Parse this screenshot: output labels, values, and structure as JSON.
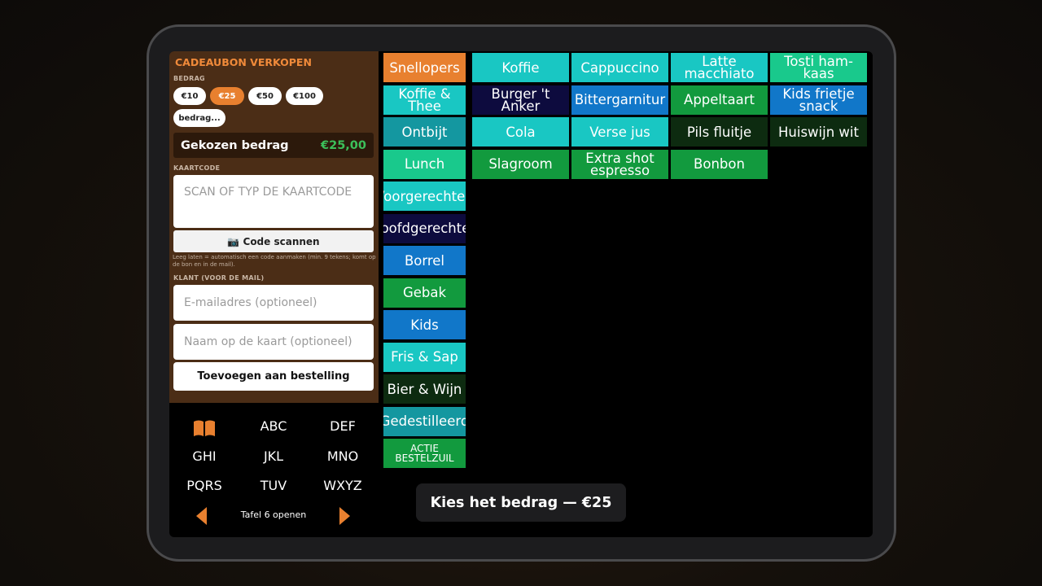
{
  "giftcard": {
    "title": "CADEAUBON VERKOPEN",
    "amount_label": "BEDRAG",
    "amounts": [
      "€10",
      "€25",
      "€50",
      "€100",
      "bedrag..."
    ],
    "selected_amount": "€25",
    "chosen_label": "Gekozen bedrag",
    "chosen_value": "€25,00",
    "code_label": "KAARTCODE",
    "code_placeholder": "SCAN OF TYP DE KAARTCODE",
    "scan_button": "📷 Code scannen",
    "hint": "Leeg laten = automatisch een code aanmaken (min. 9 tekens; komt op de bon en in de mail).",
    "customer_label": "KLANT (VOOR DE MAIL)",
    "email_placeholder": "E-mailadres (optioneel)",
    "name_placeholder": "Naam op de kaart (optioneel)",
    "add_button": "Toevoegen aan bestelling"
  },
  "keypad": {
    "keys": [
      "ABC",
      "DEF",
      "GHI",
      "JKL",
      "MNO",
      "PQRS",
      "TUV",
      "WXYZ"
    ],
    "book_icon": "book-icon",
    "table_text": "Tafel 6 openen"
  },
  "categories": [
    {
      "label": "Snellopers",
      "color": "#e8802f"
    },
    {
      "label": "Koffie & Thee",
      "color": "#19c7c3"
    },
    {
      "label": "Ontbijt",
      "color": "#1497a0"
    },
    {
      "label": "Lunch",
      "color": "#19c98c"
    },
    {
      "label": "Voorgerechten",
      "color": "#19c7c3"
    },
    {
      "label": "Hoofdgerechten",
      "color": "#0d0b3e"
    },
    {
      "label": "Borrel",
      "color": "#1177c9"
    },
    {
      "label": "Gebak",
      "color": "#129a3e"
    },
    {
      "label": "Kids",
      "color": "#1177c9"
    },
    {
      "label": "Fris & Sap",
      "color": "#19c7c3"
    },
    {
      "label": "Bier & Wijn",
      "color": "#0d2b10"
    },
    {
      "label": "Gedestilleerd",
      "color": "#1497a0"
    },
    {
      "label": "ACTIE BESTELZUIL",
      "color": "#129a3e"
    }
  ],
  "products": [
    {
      "label": "Koffie",
      "color": "#19c7c3"
    },
    {
      "label": "Cappuccino",
      "color": "#19c7c3"
    },
    {
      "label": "Latte macchiato",
      "color": "#19c7c3"
    },
    {
      "label": "Tosti ham-kaas",
      "color": "#19c98c"
    },
    {
      "label": "Burger 't Anker",
      "color": "#0d0b3e"
    },
    {
      "label": "Bittergarnitur",
      "color": "#1177c9"
    },
    {
      "label": "Appeltaart",
      "color": "#129a3e"
    },
    {
      "label": "Kids frietje snack",
      "color": "#1177c9"
    },
    {
      "label": "Cola",
      "color": "#19c7c3"
    },
    {
      "label": "Verse jus",
      "color": "#19c7c3"
    },
    {
      "label": "Pils fluitje",
      "color": "#0d2b10"
    },
    {
      "label": "Huiswijn wit",
      "color": "#0d2b10"
    },
    {
      "label": "Slagroom",
      "color": "#129a3e"
    },
    {
      "label": "Extra shot espresso",
      "color": "#129a3e"
    },
    {
      "label": "Bonbon",
      "color": "#129a3e"
    }
  ],
  "toast": "Kies het bedrag — €25"
}
